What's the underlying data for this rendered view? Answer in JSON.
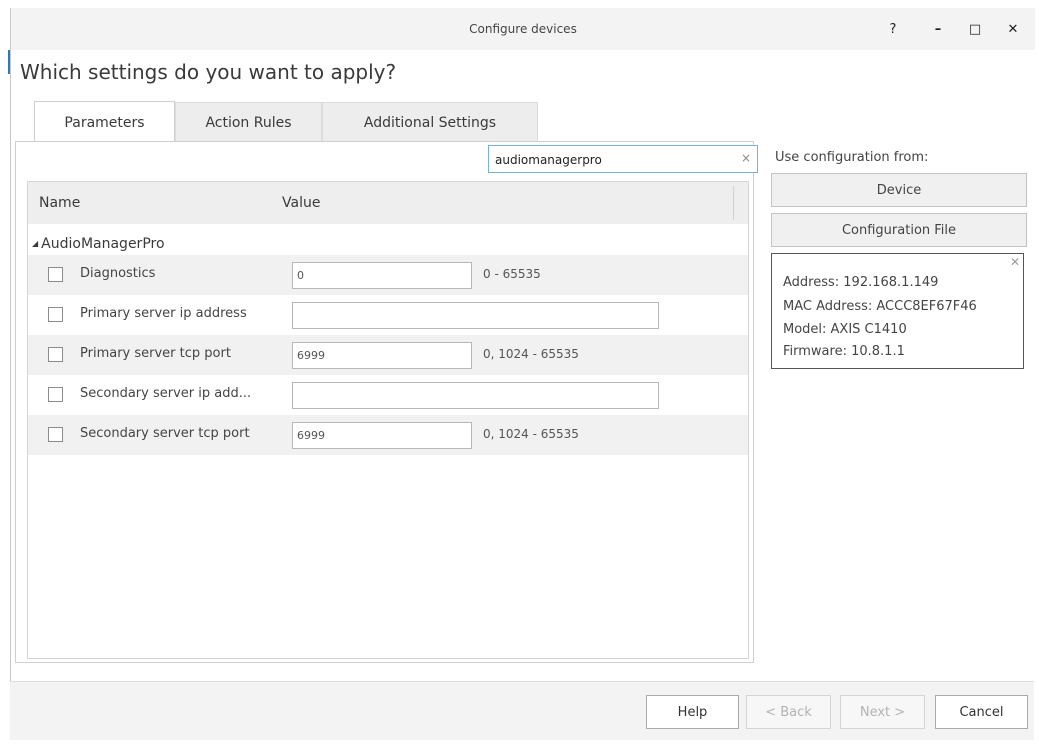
{
  "window": {
    "title": "Configure devices",
    "controls": {
      "help": "?",
      "minimize": "–",
      "maximize": "□",
      "close": "✕"
    }
  },
  "heading": "Which settings do you want to apply?",
  "tabs": [
    {
      "label": "Parameters",
      "active": true
    },
    {
      "label": "Action Rules",
      "active": false
    },
    {
      "label": "Additional Settings",
      "active": false
    }
  ],
  "search": {
    "value": "audiomanagerpro",
    "clear_icon": "×"
  },
  "grid": {
    "columns": {
      "name": "Name",
      "value": "Value"
    },
    "group": {
      "label": "AudioManagerPro",
      "expander": "◢"
    },
    "rows": [
      {
        "label": "Diagnostics",
        "value": "0",
        "range": "0 - 65535",
        "checked": false
      },
      {
        "label": "Primary server ip address",
        "value": "",
        "range": "",
        "checked": false
      },
      {
        "label": "Primary server tcp port",
        "value": "6999",
        "range": "0, 1024 - 65535",
        "checked": false
      },
      {
        "label": "Secondary server ip add...",
        "value": "",
        "range": "",
        "checked": false
      },
      {
        "label": "Secondary server tcp port",
        "value": "6999",
        "range": "0, 1024 - 65535",
        "checked": false
      }
    ]
  },
  "side": {
    "use_config_label": "Use configuration from:",
    "device_button": "Device",
    "config_file_button": "Configuration File",
    "info": {
      "close_icon": "✕",
      "address": "Address:  192.168.1.149",
      "mac": "MAC Address:  ACCC8EF67F46",
      "model": "Model:  AXIS C1410",
      "firmware": "Firmware:  10.8.1.1"
    }
  },
  "footer": {
    "help": "Help",
    "back": "< Back",
    "next": "Next >",
    "cancel": "Cancel"
  }
}
